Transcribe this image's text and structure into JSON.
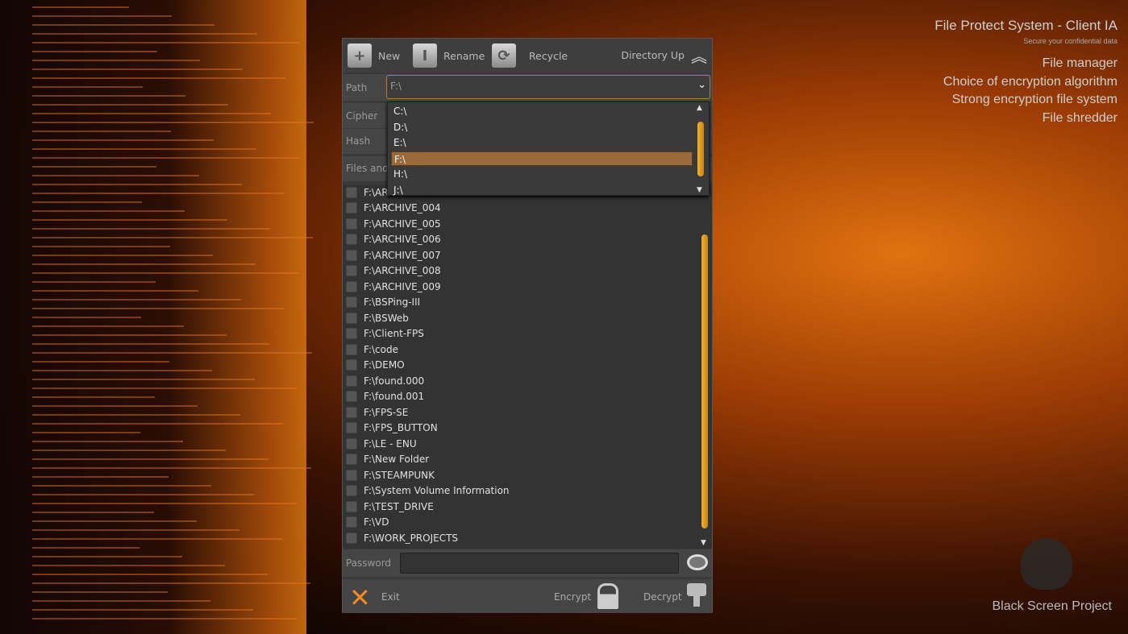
{
  "promo": {
    "title": "File Protect System - Client IA",
    "subtitle": "Secure your confidential data",
    "features": [
      "File manager",
      "Choice of encryption algorithm",
      "Strong encryption file system",
      "File shredder"
    ],
    "brand": "Black Screen Project"
  },
  "toolbar": {
    "new": "New",
    "rename": "Rename",
    "recycle": "Recycle",
    "directory_up": "Directory Up"
  },
  "form": {
    "path_label": "Path",
    "path_value": "F:\\",
    "cipher_label": "Cipher",
    "hash_label": "Hash",
    "files_label": "Files and",
    "password_label": "Password",
    "password_value": ""
  },
  "dropdown": {
    "options": [
      "C:\\",
      "D:\\",
      "E:\\",
      "F:\\",
      "H:\\",
      "J:\\"
    ],
    "selected_index": 3
  },
  "files": [
    "F:\\AR",
    "F:\\ARCHIVE_004",
    "F:\\ARCHIVE_005",
    "F:\\ARCHIVE_006",
    "F:\\ARCHIVE_007",
    "F:\\ARCHIVE_008",
    "F:\\ARCHIVE_009",
    "F:\\BSPing-III",
    "F:\\BSWeb",
    "F:\\Client-FPS",
    "F:\\code",
    "F:\\DEMO",
    "F:\\found.000",
    "F:\\found.001",
    "F:\\FPS-SE",
    "F:\\FPS_BUTTON",
    "F:\\LE - ENU",
    "F:\\New Folder",
    "F:\\STEAMPUNK",
    "F:\\System Volume Information",
    "F:\\TEST_DRIVE",
    "F:\\VD",
    "F:\\WORK_PROJECTS"
  ],
  "bottom": {
    "exit": "Exit",
    "encrypt": "Encrypt",
    "decrypt": "Decrypt"
  },
  "colors": {
    "accent": "#e8a020",
    "selected": "#9a6a3a"
  }
}
